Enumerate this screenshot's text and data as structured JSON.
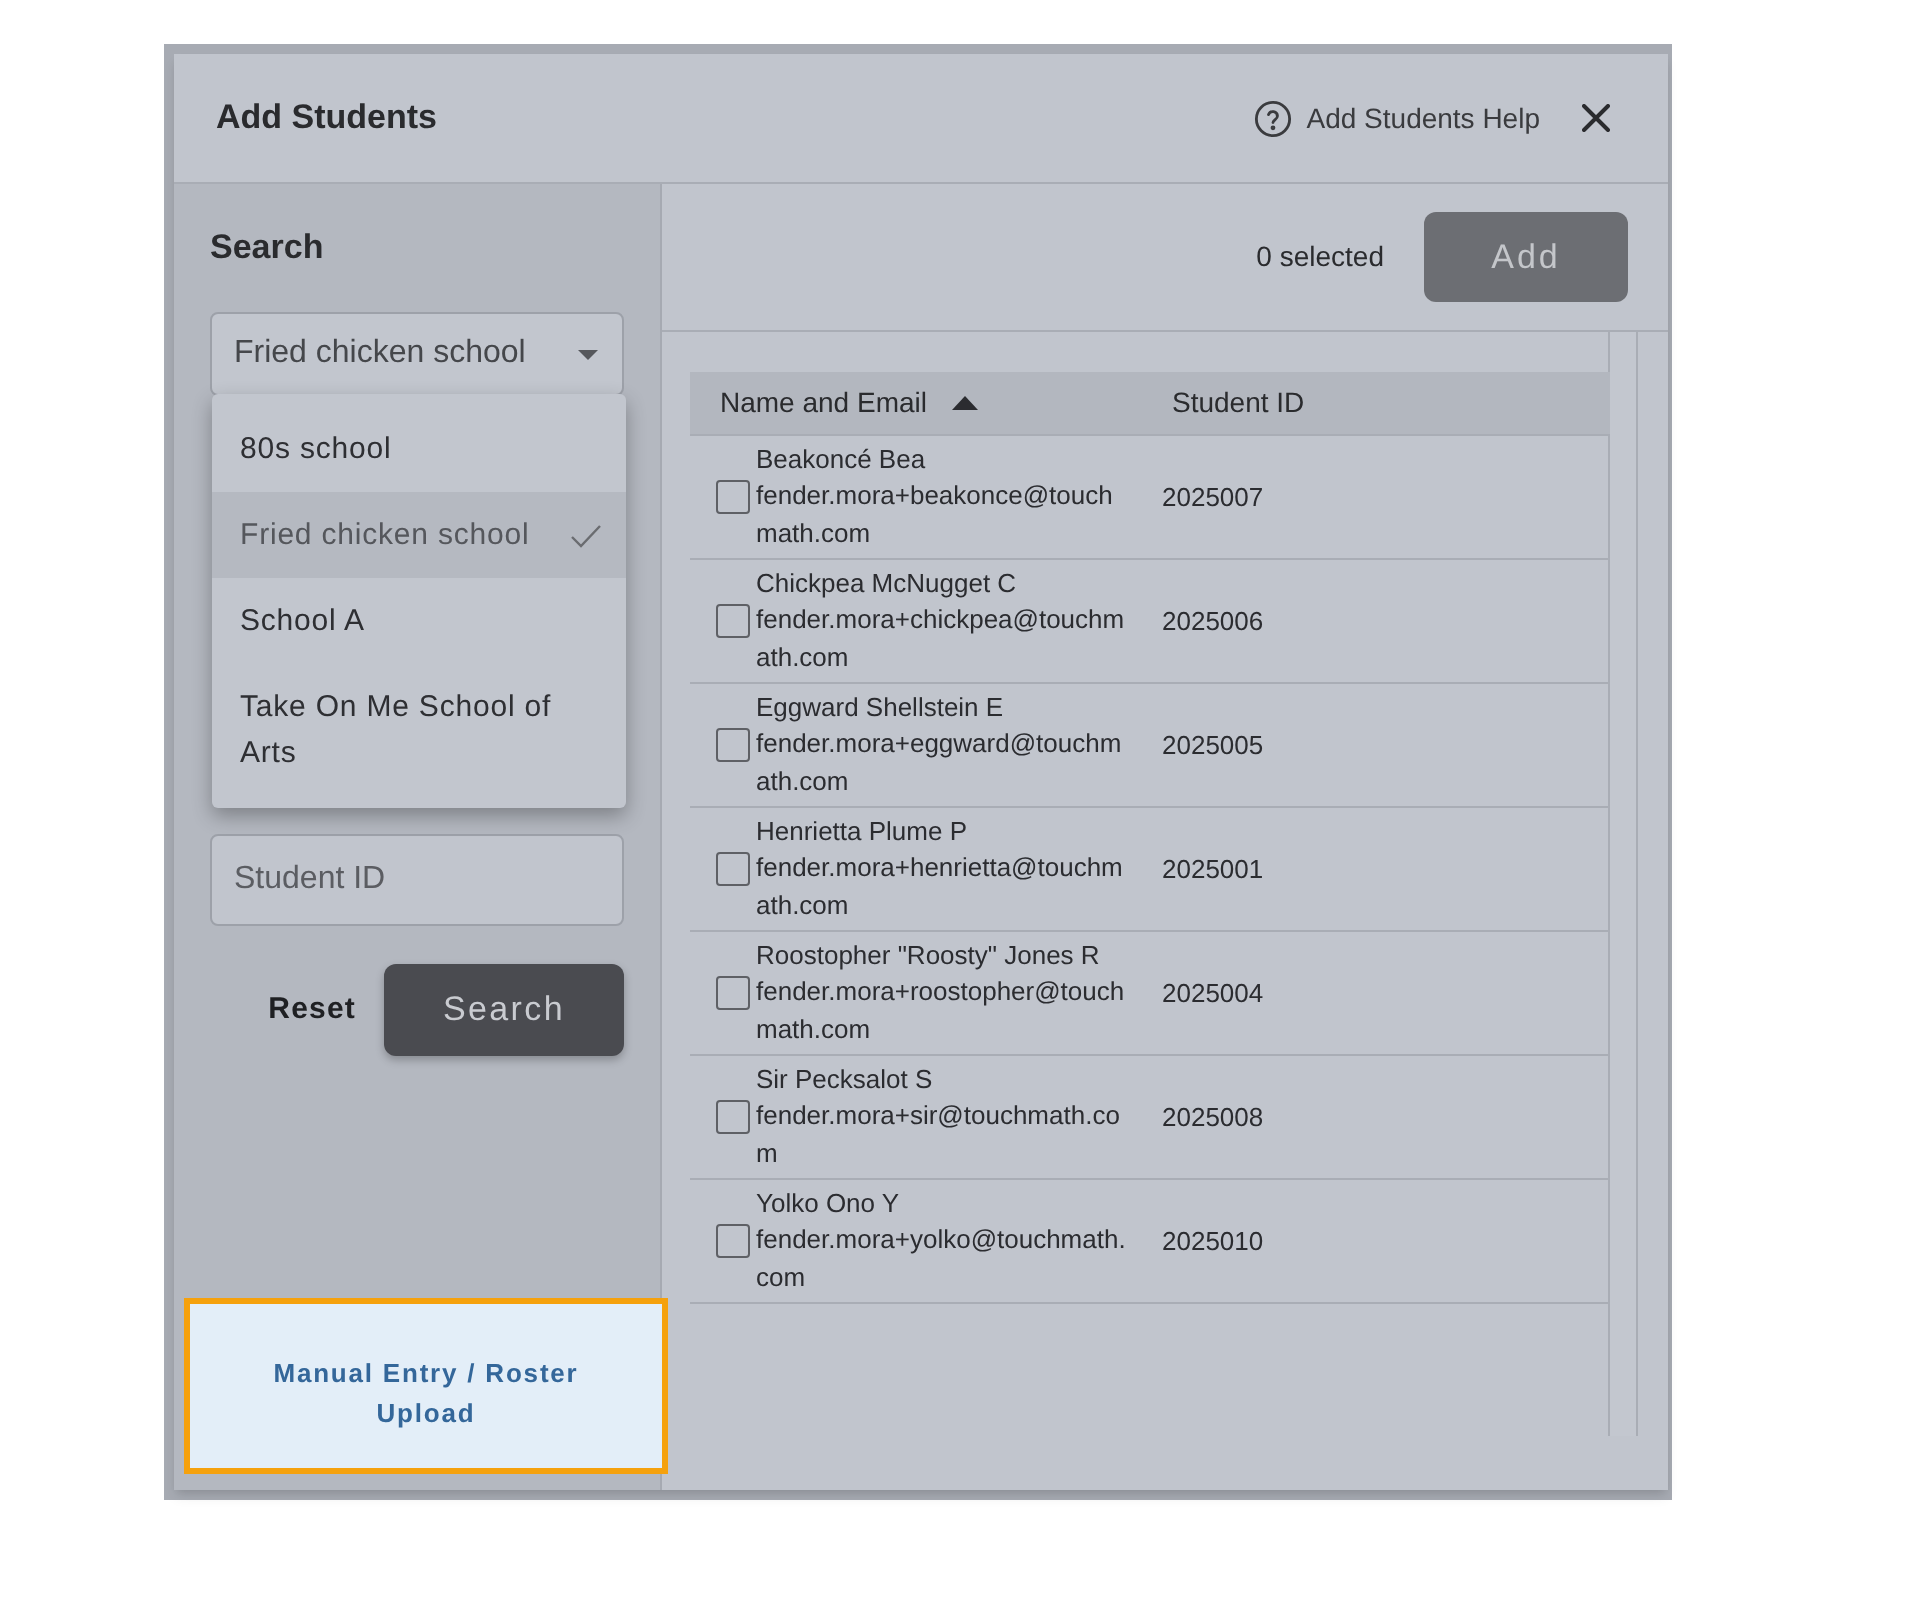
{
  "dialog": {
    "title": "Add Students",
    "help_link": "Add Students Help"
  },
  "search_panel": {
    "heading": "Search",
    "school_select": {
      "value": "Fried chicken school",
      "expanded": true,
      "options": [
        {
          "label": "80s school",
          "selected": false
        },
        {
          "label": "Fried chicken school",
          "selected": true
        },
        {
          "label": "School A",
          "selected": false
        },
        {
          "label": "Take On Me School of Arts",
          "selected": false
        }
      ]
    },
    "student_id_field": {
      "placeholder": "Student ID"
    },
    "reset_button": "Reset",
    "search_button": "Search",
    "manual_entry_link": {
      "label": "Manual Entry / Roster Upload",
      "highlighted": true
    }
  },
  "results": {
    "selected_count": "0 selected",
    "add_button": {
      "label": "Add",
      "disabled": true
    },
    "table": {
      "columns": [
        {
          "label": "Name and Email",
          "sorted": true
        },
        {
          "label": "Student ID",
          "sorted": false
        }
      ],
      "rows": [
        {
          "name": "Beakoncé Bea",
          "email": "fender.mora+beakonce@touchmath.com",
          "student_id": "2025007",
          "checked": false
        },
        {
          "name": "Chickpea McNugget C",
          "email": "fender.mora+chickpea@touchmath.com",
          "student_id": "2025006",
          "checked": false
        },
        {
          "name": "Eggward Shellstein E",
          "email": "fender.mora+eggward@touchmath.com",
          "student_id": "2025005",
          "checked": false
        },
        {
          "name": "Henrietta Plume P",
          "email": "fender.mora+henrietta@touchmath.com",
          "student_id": "2025001",
          "checked": false
        },
        {
          "name": "Roostopher \"Roosty\" Jones R",
          "email": "fender.mora+roostopher@touchmath.com",
          "student_id": "2025004",
          "checked": false
        },
        {
          "name": "Sir Pecksalot S",
          "email": "fender.mora+sir@touchmath.com",
          "student_id": "2025008",
          "checked": false
        },
        {
          "name": "Yolko Ono Y",
          "email": "fender.mora+yolko@touchmath.com",
          "student_id": "2025010",
          "checked": false
        }
      ]
    }
  }
}
